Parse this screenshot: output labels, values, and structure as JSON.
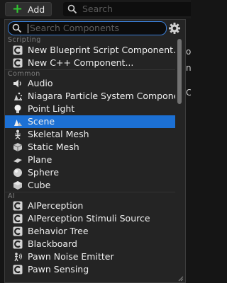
{
  "toolbar": {
    "add_label": "Add",
    "search_placeholder": "Search"
  },
  "side_peek": {
    "line1": "o",
    "line2": "n",
    "line3": "C"
  },
  "menu": {
    "search_placeholder": "Search Components",
    "categories": [
      {
        "label": "Scripting",
        "items": [
          {
            "label": "New Blueprint Script Component...",
            "icon": "blueprint-c-icon"
          },
          {
            "label": "New C++ Component...",
            "icon": "cpp-c-icon"
          }
        ]
      },
      {
        "label": "Common",
        "items": [
          {
            "label": "Audio",
            "icon": "speaker-icon"
          },
          {
            "label": "Niagara Particle System Component",
            "icon": "particle-icon"
          },
          {
            "label": "Point Light",
            "icon": "lightbulb-icon"
          },
          {
            "label": "Scene",
            "icon": "scene-icon",
            "selected": true
          },
          {
            "label": "Skeletal Mesh",
            "icon": "skeleton-icon"
          },
          {
            "label": "Static Mesh",
            "icon": "static-mesh-icon"
          },
          {
            "label": "Plane",
            "icon": "plane-icon"
          },
          {
            "label": "Sphere",
            "icon": "sphere-icon"
          },
          {
            "label": "Cube",
            "icon": "cube-icon"
          }
        ]
      },
      {
        "label": "AI",
        "items": [
          {
            "label": "AIPerception",
            "icon": "component-c-icon"
          },
          {
            "label": "AIPerception Stimuli Source",
            "icon": "component-c-icon"
          },
          {
            "label": "Behavior Tree",
            "icon": "component-c-icon"
          },
          {
            "label": "Blackboard",
            "icon": "component-c-icon"
          },
          {
            "label": "Pawn Noise Emitter",
            "icon": "noise-emitter-icon"
          },
          {
            "label": "Pawn Sensing",
            "icon": "component-c-icon"
          }
        ]
      }
    ]
  },
  "colors": {
    "accent": "#1c70d4",
    "focus_border": "#3b7fd8",
    "add_plus": "#32c832",
    "background": "#242424"
  }
}
